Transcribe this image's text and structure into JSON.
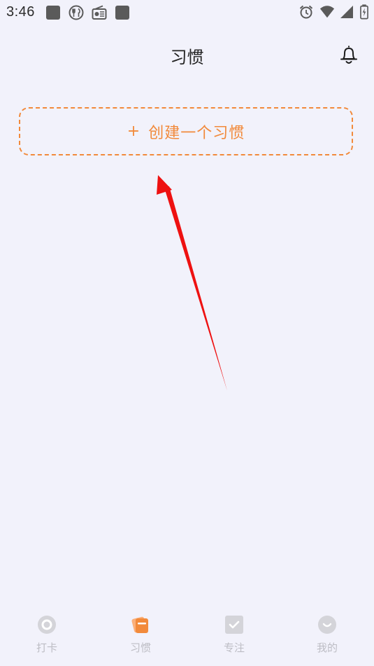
{
  "status_bar": {
    "time": "3:46",
    "left_icons": [
      "square-notification-icon",
      "restaurant-icon",
      "radio-icon",
      "square-notification-icon"
    ],
    "right_icons": [
      "alarm-icon",
      "wifi-icon",
      "signal-icon",
      "battery-icon"
    ]
  },
  "header": {
    "title": "习惯",
    "right_icon": "bell-icon"
  },
  "main": {
    "create_button": {
      "plus": "+",
      "label": "创建一个习惯"
    },
    "annotation": "red-arrow-pointing-to-create-button"
  },
  "tabbar": {
    "tabs": [
      {
        "label": "打卡",
        "icon": "checkin-circle-icon",
        "active": false
      },
      {
        "label": "习惯",
        "icon": "habit-cards-icon",
        "active": true
      },
      {
        "label": "专注",
        "icon": "focus-check-icon",
        "active": false
      },
      {
        "label": "我的",
        "icon": "profile-smile-icon",
        "active": false
      }
    ]
  },
  "colors": {
    "background": "#f2f2fb",
    "accent": "#f28a3b",
    "tab_inactive": "#bdbdc4",
    "arrow": "#ee1111"
  }
}
